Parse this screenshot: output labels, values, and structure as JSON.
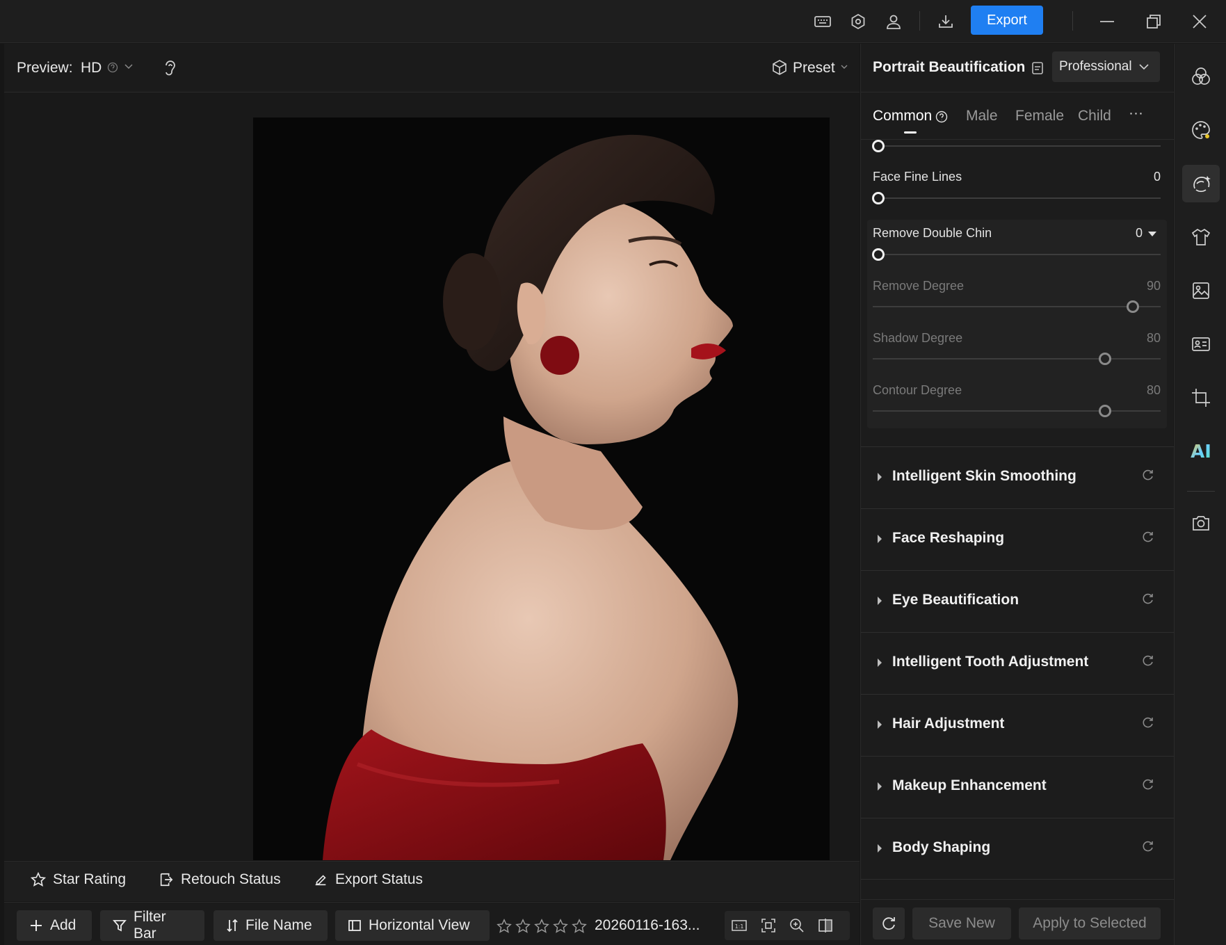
{
  "titlebar": {
    "export_label": "Export",
    "icons": [
      "keyboard-icon",
      "settings-icon",
      "user-icon",
      "download-icon",
      "minimize-icon",
      "restore-icon",
      "close-icon"
    ]
  },
  "preview": {
    "label": "Preview:",
    "quality": "HD",
    "preset_label": "Preset"
  },
  "status_bar": {
    "star_rating": "Star Rating",
    "retouch_status": "Retouch Status",
    "export_status": "Export Status"
  },
  "toolbar": {
    "add": "Add",
    "filter_bar": "Filter Bar",
    "file_name": "File Name",
    "horizontal_view": "Horizontal View",
    "filename_value": "20260116-163...",
    "rating": 0
  },
  "panel": {
    "title": "Portrait Beautification",
    "mode": "Professional",
    "tabs": [
      {
        "label": "Common",
        "active": true
      },
      {
        "label": "Male",
        "active": false
      },
      {
        "label": "Female",
        "active": false
      },
      {
        "label": "Child",
        "active": false
      }
    ],
    "more": "···",
    "sliders": {
      "top": {
        "value": 0
      },
      "face_fine_lines": {
        "label": "Face Fine Lines",
        "value": "0",
        "level": 0
      },
      "remove_double_chin": {
        "label": "Remove Double Chin",
        "value": "0",
        "level": 0
      },
      "remove_degree": {
        "label": "Remove Degree",
        "value": "90",
        "level": 90
      },
      "shadow_degree": {
        "label": "Shadow Degree",
        "value": "80",
        "level": 80
      },
      "contour_degree": {
        "label": "Contour Degree",
        "value": "80",
        "level": 80
      }
    },
    "sections": [
      "Intelligent Skin Smoothing",
      "Face Reshaping",
      "Eye Beautification",
      "Intelligent Tooth Adjustment",
      "Hair Adjustment",
      "Makeup Enhancement",
      "Body Shaping"
    ],
    "footer": {
      "save_new": "Save New",
      "apply_to_selected": "Apply to Selected"
    }
  },
  "rail": {
    "ai_label": "AI",
    "icons": [
      "color-circles-icon",
      "palette-icon",
      "face-retouch-icon",
      "clothing-icon",
      "image-icon",
      "id-card-icon",
      "crop-icon",
      "ai-icon",
      "camera-icon"
    ],
    "active_index": 2
  },
  "colors": {
    "accent": "#1f7ff2",
    "background": "#161616",
    "dress_red": "#8a0e14"
  }
}
